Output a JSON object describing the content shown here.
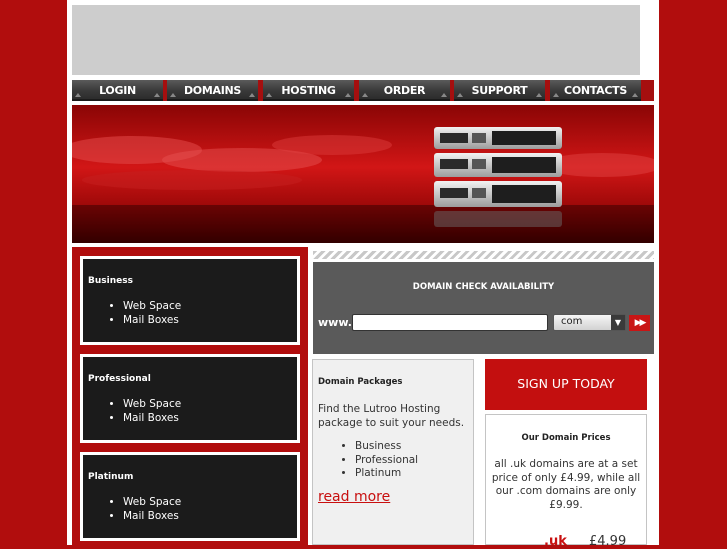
{
  "nav": [
    {
      "id": "login",
      "label": "LOGIN"
    },
    {
      "id": "domains",
      "label": "DOMAINS"
    },
    {
      "id": "hosting",
      "label": "HOSTING"
    },
    {
      "id": "order",
      "label": "ORDER"
    },
    {
      "id": "support",
      "label": "SUPPORT"
    },
    {
      "id": "contacts",
      "label": "CONTACTS"
    }
  ],
  "packages": [
    {
      "title": "Business",
      "items": [
        "Web Space",
        "Mail Boxes"
      ]
    },
    {
      "title": "Professional",
      "items": [
        "Web Space",
        "Mail Boxes"
      ]
    },
    {
      "title": "Platinum",
      "items": [
        "Web Space",
        "Mail Boxes"
      ]
    }
  ],
  "domain_check": {
    "title": "DOMAIN CHECK AVAILABILITY",
    "prefix": "www.",
    "input_value": "",
    "tld_selected": "com"
  },
  "domain_packages": {
    "title": "Domain Packages",
    "description": "Find the Lutroo Hosting package to suit your needs.",
    "items": [
      "Business",
      "Professional",
      "Platinum"
    ],
    "link": "read more"
  },
  "signup": {
    "label": "SIGN UP TODAY"
  },
  "prices": {
    "title": "Our Domain Prices",
    "text": "all .uk domains are at a set price of only £4.99, while all our .com domains are only £9.99.",
    "uk_label": ".uk",
    "uk_price": "£4.99"
  },
  "colors": {
    "brand_red": "#b10d0d",
    "dark": "#1b1b1b",
    "panel_gray": "#5a5a5a"
  }
}
